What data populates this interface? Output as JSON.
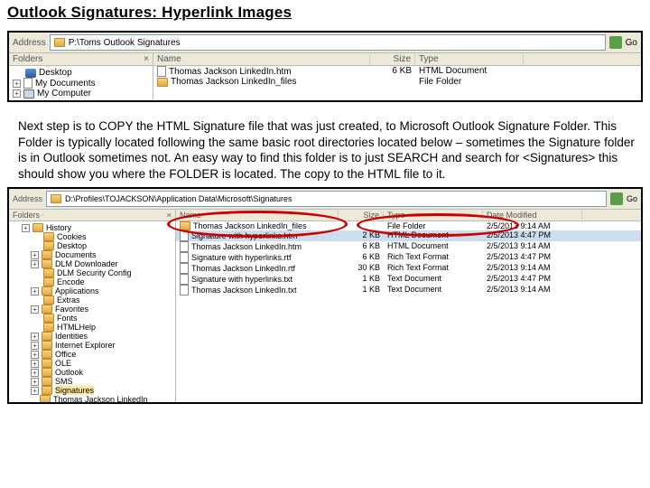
{
  "title": "Outlook Signatures: Hyperlink Images",
  "explorer1": {
    "address_label": "Address",
    "address_value": "P:\\Toms Outlook Signatures",
    "go_label": "Go",
    "folders_label": "Folders",
    "close_x": "×",
    "tree": [
      {
        "icon": "desk",
        "label": "Desktop",
        "indent": 0,
        "expander": ""
      },
      {
        "icon": "doc",
        "label": "My Documents",
        "indent": 0,
        "expander": "+"
      },
      {
        "icon": "comp",
        "label": "My Computer",
        "indent": 0,
        "expander": "+"
      }
    ],
    "columns": {
      "name": "Name",
      "size": "Size",
      "type": "Type"
    },
    "rows": [
      {
        "icon": "file",
        "name": "Thomas Jackson LinkedIn.htm",
        "size": "6 KB",
        "type": "HTML Document"
      },
      {
        "icon": "folder",
        "name": "Thomas Jackson LinkedIn_files",
        "size": "",
        "type": "File Folder"
      }
    ]
  },
  "paragraph": "Next step is to COPY the HTML Signature file that was just created, to Microsoft Outlook Signature Folder.  This Folder is typically located following the same basic root directories located below – sometimes the Signature folder is in Outlook sometimes not.  An easy way to find this folder is to just SEARCH and search for <Signatures> this should show you where the FOLDER is located.  The copy to the HTML file to it.",
  "explorer2": {
    "address_label": "Address",
    "address_value": "D:\\Profiles\\TOJACKSON\\Application Data\\Microsoft\\Signatures",
    "go_label": "Go",
    "folders_label": "Folders",
    "close_x": "×",
    "tree": [
      {
        "label": "History",
        "indent": 1,
        "expander": "+"
      },
      {
        "label": "Cookies",
        "indent": 2,
        "expander": ""
      },
      {
        "label": "Desktop",
        "indent": 2,
        "expander": ""
      },
      {
        "label": "Documents",
        "indent": 2,
        "expander": "+"
      },
      {
        "label": "DLM Downloader",
        "indent": 2,
        "expander": "+"
      },
      {
        "label": "DLM Security Config",
        "indent": 2,
        "expander": ""
      },
      {
        "label": "Encode",
        "indent": 2,
        "expander": ""
      },
      {
        "label": "Applications",
        "indent": 2,
        "expander": "+"
      },
      {
        "label": "Extras",
        "indent": 2,
        "expander": ""
      },
      {
        "label": "Favorites",
        "indent": 2,
        "expander": "+"
      },
      {
        "label": "Fonts",
        "indent": 2,
        "expander": ""
      },
      {
        "label": "HTMLHelp",
        "indent": 2,
        "expander": ""
      },
      {
        "label": "Identities",
        "indent": 2,
        "expander": "+"
      },
      {
        "label": "Internet Explorer",
        "indent": 2,
        "expander": "+"
      },
      {
        "label": "Office",
        "indent": 2,
        "expander": "+"
      },
      {
        "label": "OLE",
        "indent": 2,
        "expander": "+"
      },
      {
        "label": "Outlook",
        "indent": 2,
        "expander": "+"
      },
      {
        "label": "SMS",
        "indent": 2,
        "expander": "+"
      },
      {
        "label": "Signatures",
        "indent": 2,
        "expander": "+",
        "selected": true
      }
    ],
    "tree_last": "Thomas Jackson LinkedIn",
    "columns": {
      "name": "Name",
      "size": "Size",
      "type": "Type",
      "date": "Date Modified"
    },
    "rows": [
      {
        "icon": "folder",
        "name": "Thomas Jackson LinkedIn_files",
        "size": "",
        "type": "File Folder",
        "date": "2/5/2013 9:14 AM"
      },
      {
        "icon": "file",
        "name": "Signature with hyperlinks.htm",
        "size": "2 KB",
        "type": "HTML Document",
        "date": "2/5/2013 4:47 PM",
        "selected": true
      },
      {
        "icon": "file",
        "name": "Thomas Jackson LinkedIn.htm",
        "size": "6 KB",
        "type": "HTML Document",
        "date": "2/5/2013 9:14 AM"
      },
      {
        "icon": "file",
        "name": "Signature with hyperlinks.rtf",
        "size": "6 KB",
        "type": "Rich Text Format",
        "date": "2/5/2013 4:47 PM"
      },
      {
        "icon": "file",
        "name": "Thomas Jackson LinkedIn.rtf",
        "size": "30 KB",
        "type": "Rich Text Format",
        "date": "2/5/2013 9:14 AM"
      },
      {
        "icon": "file",
        "name": "Signature with hyperlinks.txt",
        "size": "1 KB",
        "type": "Text Document",
        "date": "2/5/2013 4:47 PM"
      },
      {
        "icon": "file",
        "name": "Thomas Jackson LinkedIn.txt",
        "size": "1 KB",
        "type": "Text Document",
        "date": "2/5/2013 9:14 AM"
      }
    ]
  }
}
